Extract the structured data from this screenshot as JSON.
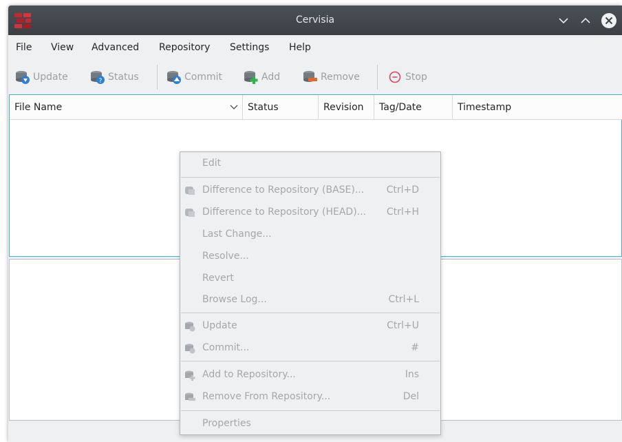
{
  "window": {
    "title": "Cervisia"
  },
  "menubar": {
    "items": [
      "File",
      "View",
      "Advanced",
      "Repository",
      "Settings",
      "Help"
    ]
  },
  "toolbar": {
    "update": "Update",
    "status": "Status",
    "commit": "Commit",
    "add": "Add",
    "remove": "Remove",
    "stop": "Stop"
  },
  "filelist": {
    "columns": [
      "File Name",
      "Status",
      "Revision",
      "Tag/Date",
      "Timestamp"
    ]
  },
  "context_menu": {
    "items": [
      {
        "label": "Edit",
        "shortcut": ""
      },
      {
        "label": "Difference to Repository (BASE)...",
        "shortcut": "Ctrl+D"
      },
      {
        "label": "Difference to Repository (HEAD)...",
        "shortcut": "Ctrl+H"
      },
      {
        "label": "Last Change...",
        "shortcut": ""
      },
      {
        "label": "Resolve...",
        "shortcut": ""
      },
      {
        "label": "Revert",
        "shortcut": ""
      },
      {
        "label": "Browse Log...",
        "shortcut": "Ctrl+L"
      },
      {
        "label": "Update",
        "shortcut": "Ctrl+U"
      },
      {
        "label": "Commit...",
        "shortcut": "#"
      },
      {
        "label": "Add to Repository...",
        "shortcut": "Ins"
      },
      {
        "label": "Remove From Repository...",
        "shortcut": "Del"
      },
      {
        "label": "Properties",
        "shortcut": ""
      }
    ]
  },
  "colors": {
    "titlebar": "#3b4045",
    "accent": "#3daee9",
    "disabled_text": "#a3a8ad"
  }
}
